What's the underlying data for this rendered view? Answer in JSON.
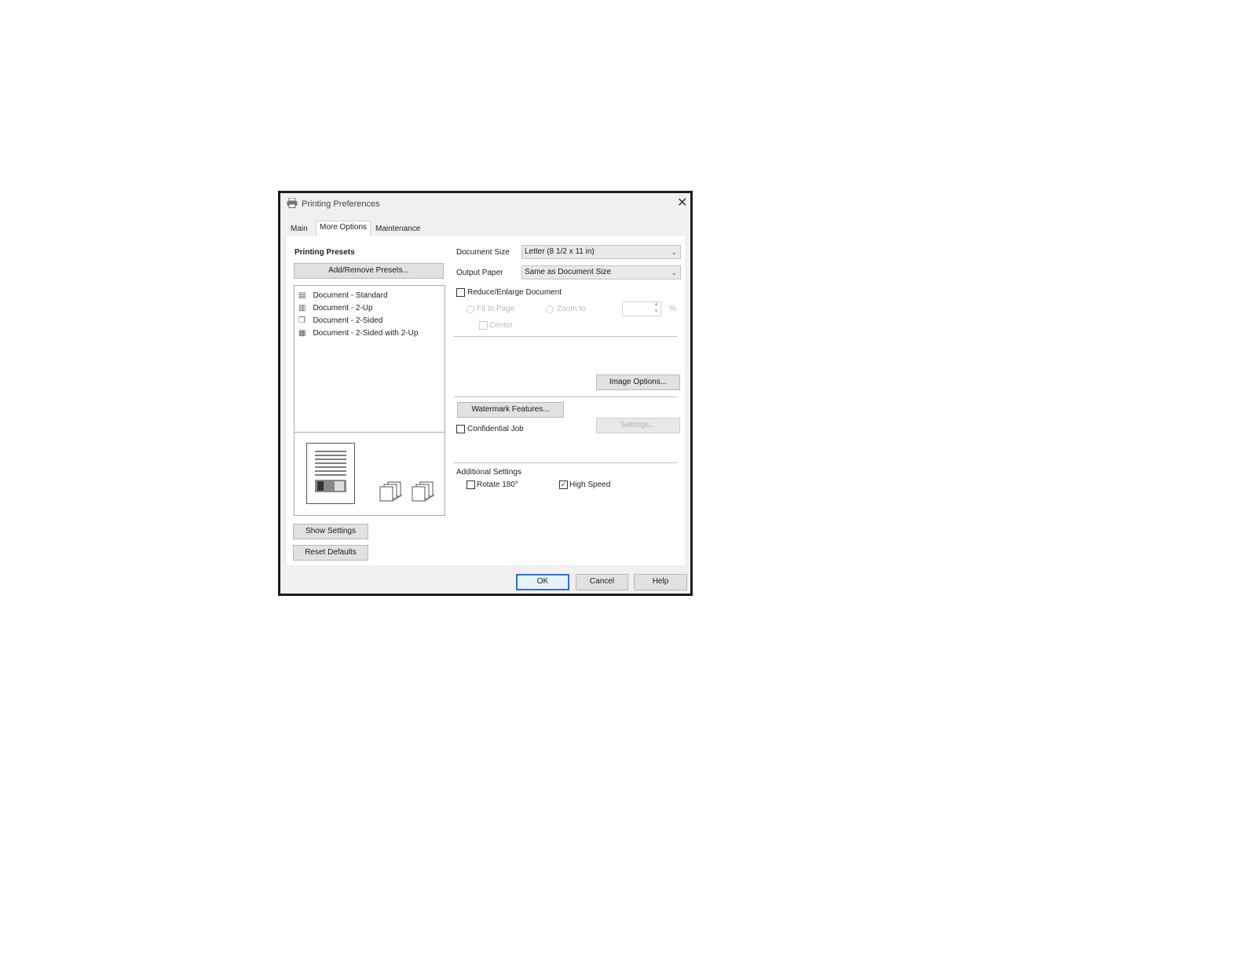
{
  "window": {
    "title": "Printing Preferences"
  },
  "tabs": [
    {
      "label": "Main"
    },
    {
      "label": "More Options"
    },
    {
      "label": "Maintenance"
    }
  ],
  "presets": {
    "heading": "Printing Presets",
    "add_remove_label": "Add/Remove Presets...",
    "items": [
      {
        "label": "Document - Standard"
      },
      {
        "label": "Document - 2-Up"
      },
      {
        "label": "Document - 2-Sided"
      },
      {
        "label": "Document - 2-Sided with 2-Up"
      }
    ]
  },
  "left_buttons": {
    "show_settings": "Show Settings",
    "reset_defaults": "Reset Defaults"
  },
  "document_size": {
    "label": "Document Size",
    "value": "Letter (8 1/2 x 11 in)"
  },
  "output_paper": {
    "label": "Output Paper",
    "value": "Same as Document Size"
  },
  "reduce_enlarge": {
    "label": "Reduce/Enlarge Document",
    "fit_to_page": "Fit to Page",
    "zoom_to": "Zoom to",
    "percent": "%",
    "center": "Center"
  },
  "image_options_label": "Image Options...",
  "watermark_label": "Watermark Features...",
  "confidential_label": "Confidential Job",
  "settings_label": "Settings...",
  "additional": {
    "heading": "Additional Settings",
    "rotate": "Rotate 180°",
    "high_speed": "High Speed"
  },
  "footer": {
    "ok": "OK",
    "cancel": "Cancel",
    "help": "Help"
  }
}
